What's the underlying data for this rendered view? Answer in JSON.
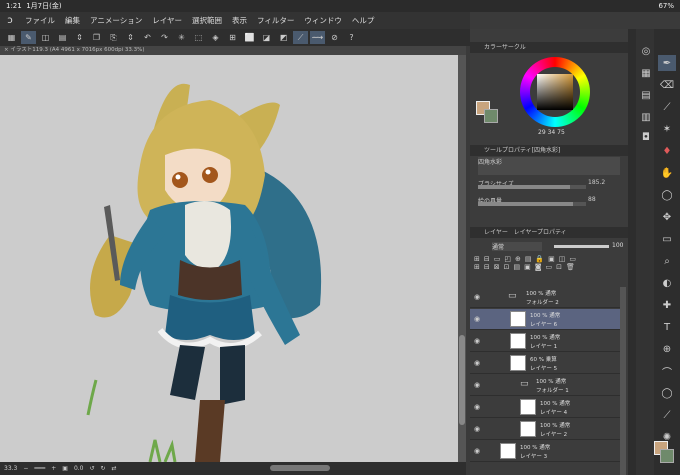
{
  "status": {
    "time": "1:21",
    "date": "1月7日(金)",
    "battery": "67%"
  },
  "menu": [
    "ファイル",
    "編集",
    "アニメーション",
    "レイヤー",
    "選択範囲",
    "表示",
    "フィルター",
    "ウィンドウ",
    "ヘルプ"
  ],
  "canvas_tab": "イラスト119.3 (A4 4961 x 7016px 600dpi 33.3%)",
  "zoom": "33.3",
  "rotation": "0.0",
  "color_panel": {
    "title": "カラーサークル",
    "h": "29",
    "s": "34",
    "v": "75",
    "main_color": "#c8a47e",
    "sub_color": "#6f8a6b"
  },
  "tool_property": {
    "title": "ツールプロパティ[四角水彩]",
    "brush_name": "四角水彩",
    "brush_size_label": "ブラシサイズ",
    "brush_size": "185.2",
    "paint_amount_label": "絵の具量",
    "paint_amount": "88"
  },
  "layer_panel": {
    "tab1": "レイヤー",
    "tab2": "レイヤープロパティ",
    "blend": "通常",
    "opacity": "100",
    "layers": [
      {
        "line1": "100 % 通常",
        "line2": "フォルダー 2",
        "kind": "folder",
        "indent": 0
      },
      {
        "line1": "100 % 通常",
        "line2": "レイヤー 6",
        "kind": "layer",
        "indent": 1,
        "selected": true
      },
      {
        "line1": "100 % 通常",
        "line2": "レイヤー 1",
        "kind": "layer",
        "indent": 1
      },
      {
        "line1": "60 % 乗算",
        "line2": "レイヤー 5",
        "kind": "layer",
        "indent": 1
      },
      {
        "line1": "100 % 通常",
        "line2": "フォルダー 1",
        "kind": "folder",
        "indent": 1
      },
      {
        "line1": "100 % 通常",
        "line2": "レイヤー 4",
        "kind": "layer",
        "indent": 2
      },
      {
        "line1": "100 % 通常",
        "line2": "レイヤー 2",
        "kind": "layer",
        "indent": 2
      },
      {
        "line1": "100 % 通常",
        "line2": "レイヤー 3",
        "kind": "layer",
        "indent": 0
      }
    ]
  }
}
